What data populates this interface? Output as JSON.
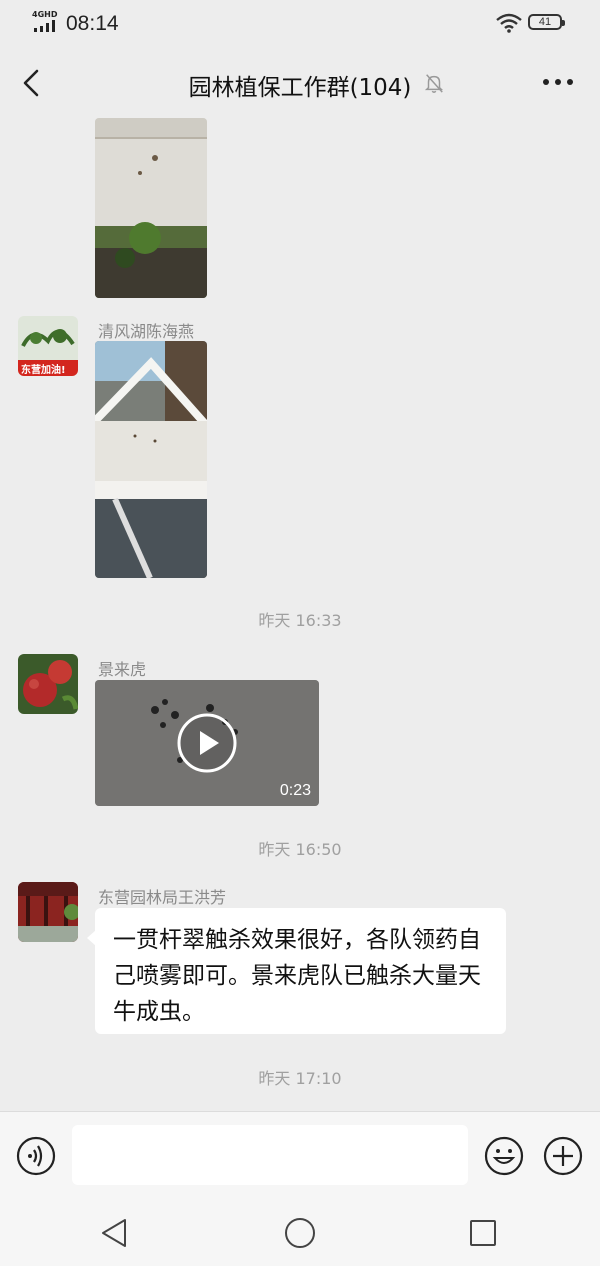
{
  "status_bar": {
    "network": "4GHD",
    "time": "08:14",
    "battery": "41"
  },
  "header": {
    "title": "园林植保工作群(104)",
    "back_icon": "chevron-left-icon",
    "mute_icon": "bell-off-icon",
    "more_icon": "more-dots-icon"
  },
  "messages": [
    {
      "type": "image",
      "sender": "",
      "description_icon": "photo"
    },
    {
      "type": "image",
      "sender": "清风湖陈海燕",
      "avatar_badge": "东营加油!"
    },
    {
      "type": "timestamp",
      "text": "昨天 16:33"
    },
    {
      "type": "video",
      "sender": "景来虎",
      "duration": "0:23"
    },
    {
      "type": "timestamp",
      "text": "昨天 16:50"
    },
    {
      "type": "text",
      "sender": "东营园林局王洪芳",
      "text": "一贯杆翠触杀效果很好，各队领药自己喷雾即可。景来虎队已触杀大量天牛成虫。"
    },
    {
      "type": "timestamp",
      "text": "昨天 17:10"
    }
  ],
  "input_bar": {
    "placeholder": "",
    "voice_icon": "voice-icon",
    "emoji_icon": "emoji-icon",
    "plus_icon": "plus-icon"
  },
  "system_nav": {
    "back_icon": "triangle-back-icon",
    "home_icon": "circle-home-icon",
    "recents_icon": "square-recents-icon"
  },
  "colors": {
    "background": "#ededed",
    "bubble": "#ffffff",
    "sender_name": "#8a8a8a",
    "timestamp": "#a0a0a0"
  }
}
